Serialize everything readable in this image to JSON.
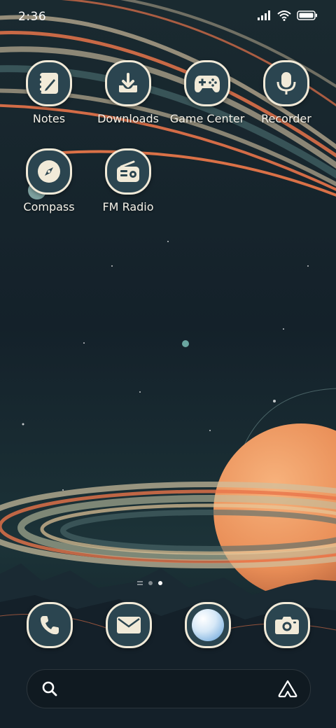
{
  "status": {
    "time": "2:36",
    "icons": [
      "signal-icon",
      "wifi-icon",
      "battery-icon"
    ]
  },
  "apps": [
    {
      "label": "Notes",
      "icon": "notes-icon"
    },
    {
      "label": "Downloads",
      "icon": "download-icon"
    },
    {
      "label": "Game Center",
      "icon": "gamepad-icon"
    },
    {
      "label": "Recorder",
      "icon": "microphone-icon"
    },
    {
      "label": "Compass",
      "icon": "compass-icon"
    },
    {
      "label": "FM Radio",
      "icon": "radio-icon"
    }
  ],
  "dock": [
    {
      "icon": "phone-icon"
    },
    {
      "icon": "mail-icon"
    },
    {
      "icon": "browser-icon"
    },
    {
      "icon": "camera-icon"
    }
  ],
  "pages": {
    "count": 3,
    "current": 2
  },
  "search": {
    "icon": "search-icon",
    "assistant_icon": "assistant-icon"
  },
  "colors": {
    "icon_background": "#2b4550",
    "icon_border": "#f1ead8",
    "sky": "#15222a",
    "planet": "#f0a06a",
    "ring_orange": "#e8744a"
  }
}
